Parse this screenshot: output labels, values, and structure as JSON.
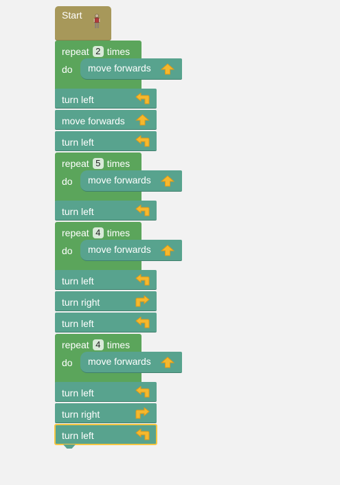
{
  "start_block": {
    "label": "Start",
    "icon": "character-icon"
  },
  "program": {
    "repeat_label": "repeat",
    "times_label": "times",
    "do_label": "do",
    "move_forwards_label": "move forwards",
    "turn_left_label": "turn left",
    "turn_right_label": "turn right",
    "repeats": [
      {
        "count": "2",
        "body": "move forwards"
      },
      {
        "count": "5",
        "body": "move forwards"
      },
      {
        "count": "4",
        "body": "move forwards"
      },
      {
        "count": "4",
        "body": "move forwards"
      }
    ]
  },
  "colors": {
    "workspace": "#f2f2f2",
    "start_block": "#a7985a",
    "repeat_block": "#5ba55b",
    "action_block": "#58a38e",
    "selected_outline": "#f7c641",
    "arrow_icon": "#f5b82e"
  }
}
